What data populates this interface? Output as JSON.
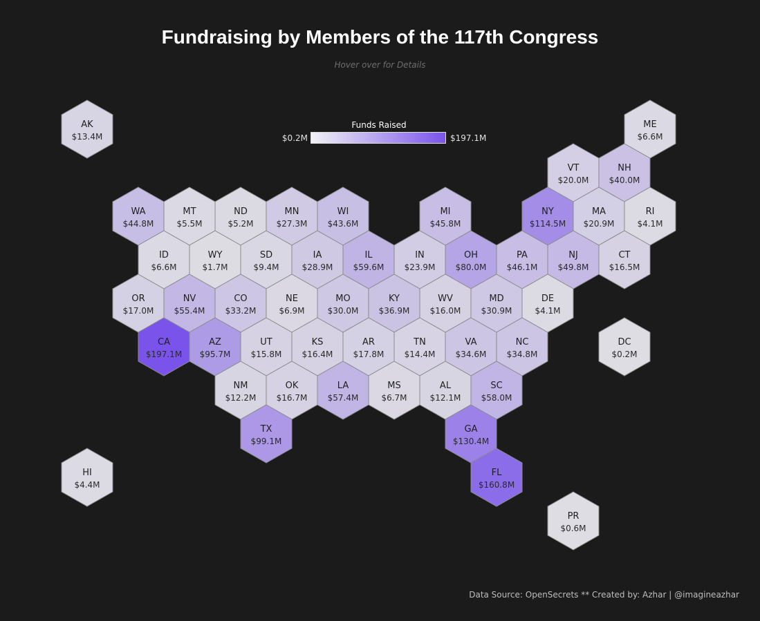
{
  "header": {
    "title": "Fundraising by Members of the 117th Congress",
    "subtitle": "Hover over for Details"
  },
  "legend": {
    "title": "Funds Raised",
    "min_label": "$0.2M",
    "max_label": "$197.1M",
    "min_color": "#f2f2f6",
    "max_color": "#7a54ea"
  },
  "footer": {
    "credit": "Data Source: OpenSecrets ** Created by: Azhar | @imagineazhar"
  },
  "chart_data": {
    "type": "hex tile map",
    "value_unit": "$M",
    "value_range": [
      0.2,
      197.1
    ],
    "states": [
      {
        "code": "AK",
        "value": 13.4,
        "label": "$13.4M",
        "row": 0,
        "col": 0
      },
      {
        "code": "ME",
        "value": 6.6,
        "label": "$6.6M",
        "row": 0,
        "col": 11
      },
      {
        "code": "VT",
        "value": 20.0,
        "label": "$20.0M",
        "row": 1,
        "col": 9
      },
      {
        "code": "NH",
        "value": 40.0,
        "label": "$40.0M",
        "row": 1,
        "col": 10
      },
      {
        "code": "WA",
        "value": 44.8,
        "label": "$44.8M",
        "row": 2,
        "col": 1
      },
      {
        "code": "MT",
        "value": 5.5,
        "label": "$5.5M",
        "row": 2,
        "col": 2
      },
      {
        "code": "ND",
        "value": 5.2,
        "label": "$5.2M",
        "row": 2,
        "col": 3
      },
      {
        "code": "MN",
        "value": 27.3,
        "label": "$27.3M",
        "row": 2,
        "col": 4
      },
      {
        "code": "WI",
        "value": 43.6,
        "label": "$43.6M",
        "row": 2,
        "col": 5
      },
      {
        "code": "MI",
        "value": 45.8,
        "label": "$45.8M",
        "row": 2,
        "col": 7
      },
      {
        "code": "NY",
        "value": 114.5,
        "label": "$114.5M",
        "row": 2,
        "col": 9
      },
      {
        "code": "MA",
        "value": 20.9,
        "label": "$20.9M",
        "row": 2,
        "col": 10
      },
      {
        "code": "RI",
        "value": 4.1,
        "label": "$4.1M",
        "row": 2,
        "col": 11
      },
      {
        "code": "ID",
        "value": 6.6,
        "label": "$6.6M",
        "row": 3,
        "col": 1
      },
      {
        "code": "WY",
        "value": 1.7,
        "label": "$1.7M",
        "row": 3,
        "col": 2
      },
      {
        "code": "SD",
        "value": 9.4,
        "label": "$9.4M",
        "row": 3,
        "col": 3
      },
      {
        "code": "IA",
        "value": 28.9,
        "label": "$28.9M",
        "row": 3,
        "col": 4
      },
      {
        "code": "IL",
        "value": 59.6,
        "label": "$59.6M",
        "row": 3,
        "col": 5
      },
      {
        "code": "IN",
        "value": 23.9,
        "label": "$23.9M",
        "row": 3,
        "col": 6
      },
      {
        "code": "OH",
        "value": 80.0,
        "label": "$80.0M",
        "row": 3,
        "col": 7
      },
      {
        "code": "PA",
        "value": 46.1,
        "label": "$46.1M",
        "row": 3,
        "col": 8
      },
      {
        "code": "NJ",
        "value": 49.8,
        "label": "$49.8M",
        "row": 3,
        "col": 9
      },
      {
        "code": "CT",
        "value": 16.5,
        "label": "$16.5M",
        "row": 3,
        "col": 10
      },
      {
        "code": "OR",
        "value": 17.0,
        "label": "$17.0M",
        "row": 4,
        "col": 1
      },
      {
        "code": "NV",
        "value": 55.4,
        "label": "$55.4M",
        "row": 4,
        "col": 2
      },
      {
        "code": "CO",
        "value": 33.2,
        "label": "$33.2M",
        "row": 4,
        "col": 3
      },
      {
        "code": "NE",
        "value": 6.9,
        "label": "$6.9M",
        "row": 4,
        "col": 4
      },
      {
        "code": "MO",
        "value": 30.0,
        "label": "$30.0M",
        "row": 4,
        "col": 5
      },
      {
        "code": "KY",
        "value": 36.9,
        "label": "$36.9M",
        "row": 4,
        "col": 6
      },
      {
        "code": "WV",
        "value": 16.0,
        "label": "$16.0M",
        "row": 4,
        "col": 7
      },
      {
        "code": "MD",
        "value": 30.9,
        "label": "$30.9M",
        "row": 4,
        "col": 8
      },
      {
        "code": "DE",
        "value": 4.1,
        "label": "$4.1M",
        "row": 4,
        "col": 9
      },
      {
        "code": "CA",
        "value": 197.1,
        "label": "$197.1M",
        "row": 5,
        "col": 1
      },
      {
        "code": "AZ",
        "value": 95.7,
        "label": "$95.7M",
        "row": 5,
        "col": 2
      },
      {
        "code": "UT",
        "value": 15.8,
        "label": "$15.8M",
        "row": 5,
        "col": 3
      },
      {
        "code": "KS",
        "value": 16.4,
        "label": "$16.4M",
        "row": 5,
        "col": 4
      },
      {
        "code": "AR",
        "value": 17.8,
        "label": "$17.8M",
        "row": 5,
        "col": 5
      },
      {
        "code": "TN",
        "value": 14.4,
        "label": "$14.4M",
        "row": 5,
        "col": 6
      },
      {
        "code": "VA",
        "value": 34.6,
        "label": "$34.6M",
        "row": 5,
        "col": 7
      },
      {
        "code": "NC",
        "value": 34.8,
        "label": "$34.8M",
        "row": 5,
        "col": 8
      },
      {
        "code": "DC",
        "value": 0.2,
        "label": "$0.2M",
        "row": 5,
        "col": 10
      },
      {
        "code": "NM",
        "value": 12.2,
        "label": "$12.2M",
        "row": 6,
        "col": 3
      },
      {
        "code": "OK",
        "value": 16.7,
        "label": "$16.7M",
        "row": 6,
        "col": 4
      },
      {
        "code": "LA",
        "value": 57.4,
        "label": "$57.4M",
        "row": 6,
        "col": 5
      },
      {
        "code": "MS",
        "value": 6.7,
        "label": "$6.7M",
        "row": 6,
        "col": 6
      },
      {
        "code": "AL",
        "value": 12.1,
        "label": "$12.1M",
        "row": 6,
        "col": 7
      },
      {
        "code": "SC",
        "value": 58.0,
        "label": "$58.0M",
        "row": 6,
        "col": 8
      },
      {
        "code": "TX",
        "value": 99.1,
        "label": "$99.1M",
        "row": 7,
        "col": 3
      },
      {
        "code": "GA",
        "value": 130.4,
        "label": "$130.4M",
        "row": 7,
        "col": 7
      },
      {
        "code": "HI",
        "value": 4.4,
        "label": "$4.4M",
        "row": 8,
        "col": 0
      },
      {
        "code": "FL",
        "value": 160.8,
        "label": "$160.8M",
        "row": 8,
        "col": 8
      },
      {
        "code": "PR",
        "value": 0.6,
        "label": "$0.6M",
        "row": 9,
        "col": 9
      }
    ]
  }
}
